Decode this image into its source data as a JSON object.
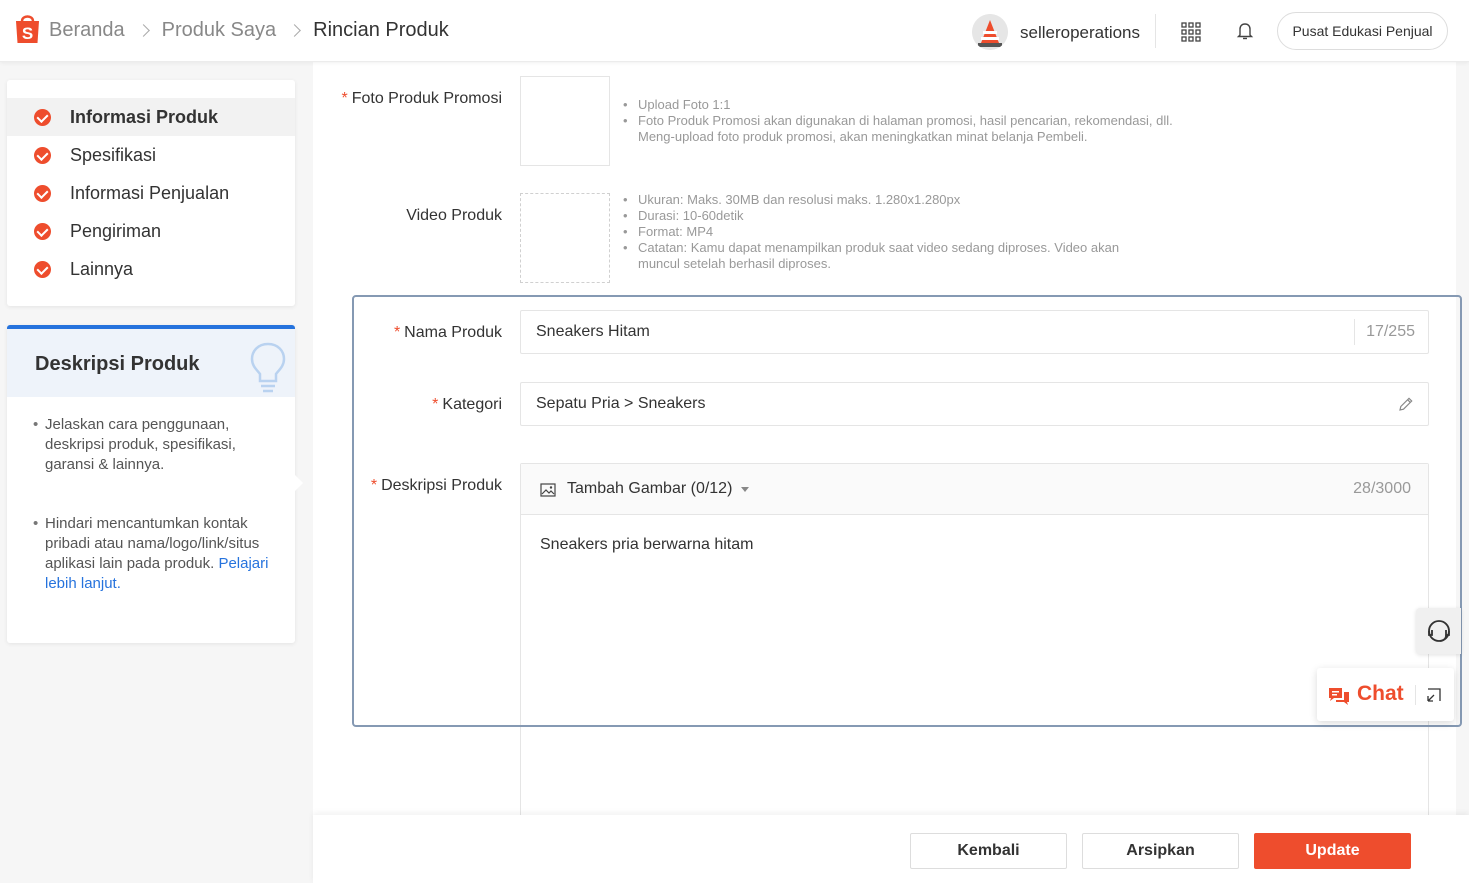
{
  "header": {
    "breadcrumbs": [
      "Beranda",
      "Produk Saya",
      "Rincian Produk"
    ],
    "username": "selleroperations",
    "edu_button": "Pusat Edukasi Penjual"
  },
  "sidebar": {
    "steps": [
      {
        "label": "Informasi Produk",
        "active": true
      },
      {
        "label": "Spesifikasi",
        "active": false
      },
      {
        "label": "Informasi Penjualan",
        "active": false
      },
      {
        "label": "Pengiriman",
        "active": false
      },
      {
        "label": "Lainnya",
        "active": false
      }
    ]
  },
  "tips": {
    "title": "Deskripsi Produk",
    "tip1": "Jelaskan cara penggunaan, deskripsi produk, spesifikasi, garansi & lainnya.",
    "tip2": "Hindari mencantumkan kontak pribadi atau nama/logo/link/situs aplikasi lain pada produk.",
    "tip2_link": "Pelajari lebih lanjut."
  },
  "form": {
    "promo_photo": {
      "label": "Foto Produk Promosi",
      "hints": [
        "Upload Foto 1:1",
        "Foto Produk Promosi akan digunakan di halaman promosi, hasil pencarian, rekomendasi, dll. Meng-upload foto produk promosi, akan meningkatkan minat belanja Pembeli."
      ]
    },
    "video": {
      "label": "Video Produk",
      "hints": [
        "Ukuran: Maks. 30MB dan resolusi maks. 1.280x1.280px",
        "Durasi: 10-60detik",
        "Format: MP4",
        "Catatan: Kamu dapat menampilkan produk saat video sedang diproses. Video akan muncul setelah berhasil diproses."
      ]
    },
    "name": {
      "label": "Nama Produk",
      "value": "Sneakers Hitam",
      "counter": "17/255"
    },
    "category": {
      "label": "Kategori",
      "value": "Sepatu Pria > Sneakers"
    },
    "description": {
      "label": "Deskripsi Produk",
      "add_image": "Tambah Gambar (0/12)",
      "counter": "28/3000",
      "value": "Sneakers pria berwarna hitam"
    }
  },
  "footer": {
    "back": "Kembali",
    "archive": "Arsipkan",
    "update": "Update"
  },
  "chat": {
    "label": "Chat"
  },
  "colors": {
    "brand": "#ee4d2d",
    "link": "#2673dd",
    "highlight": "#8599b3"
  }
}
